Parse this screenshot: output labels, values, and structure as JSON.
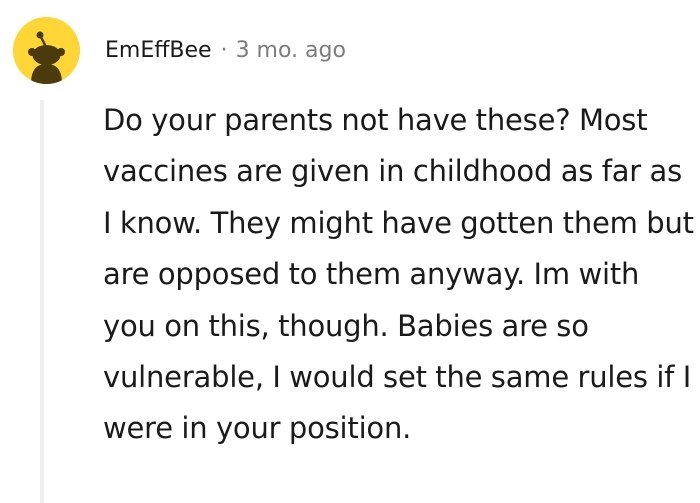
{
  "comment": {
    "username": "EmEffBee",
    "separator": "·",
    "timestamp": "3 mo. ago",
    "avatar_icon": "snoo-avatar-icon",
    "avatar_color": "#ffd635",
    "body": "Do your parents not have these? Most vaccines are given in childhood as far as I know. They might have gotten them but are opposed to them anyway. Im with you on this, though. Babies are so vulnerable, I would set the same rules if I were in your position."
  }
}
